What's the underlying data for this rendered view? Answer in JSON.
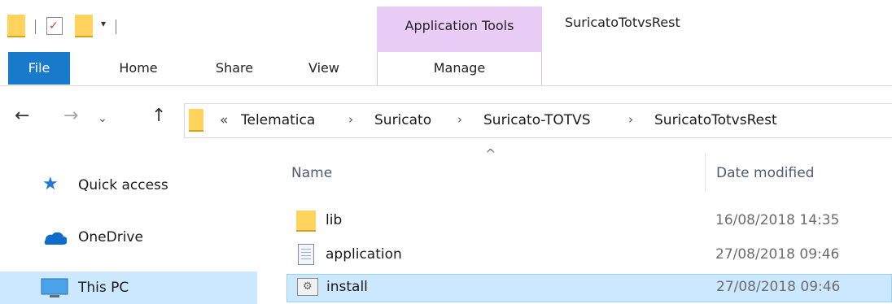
{
  "titlebar": {
    "context_tab": "Application Tools",
    "window_title": "SuricatoTotvsRest"
  },
  "ribbon": {
    "tabs": [
      "File",
      "Home",
      "Share",
      "View",
      "Manage"
    ]
  },
  "address": {
    "overflow": "«",
    "crumbs": [
      "Telematica",
      "Suricato",
      "Suricato-TOTVS",
      "SuricatoTotvsRest"
    ],
    "separator": "›"
  },
  "nav_pane": {
    "items": [
      {
        "label": "Quick access",
        "icon": "star-icon"
      },
      {
        "label": "OneDrive",
        "icon": "cloud-icon"
      },
      {
        "label": "This PC",
        "icon": "monitor-icon",
        "selected": true
      }
    ]
  },
  "columns": {
    "name": "Name",
    "date": "Date modified"
  },
  "files": [
    {
      "name": "lib",
      "date": "16/08/2018 14:35",
      "icon": "folder-icon"
    },
    {
      "name": "application",
      "date": "27/08/2018 09:46",
      "icon": "document-icon"
    },
    {
      "name": "install",
      "date": "27/08/2018 09:46",
      "icon": "batch-file-icon",
      "selected": true
    }
  ],
  "colors": {
    "accent": "#1979ca",
    "selection": "#cce8ff",
    "context_tab": "#e9cdf7",
    "folder": "#ffd35c"
  }
}
